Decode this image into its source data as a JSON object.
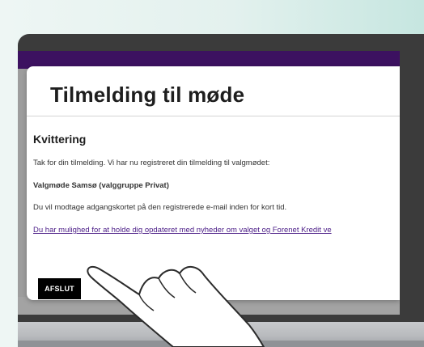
{
  "page": {
    "title": "Tilmelding til møde"
  },
  "receipt": {
    "heading": "Kvittering",
    "thanks_text": "Tak for din tilmelding. Vi har nu registreret din tilmelding til valgmødet:",
    "meeting_name": "Valgmøde Samsø (valggruppe Privat)",
    "card_info": "Du vil modtage adgangskortet på den registrerede e-mail inden for kort tid.",
    "newsletter_link": "Du har mulighed for at holde dig opdateret med nyheder om valget og Forenet Kredit ve"
  },
  "actions": {
    "finish_label": "AFSLUT"
  },
  "colors": {
    "header_bar": "#3c1160",
    "link": "#4b1d87",
    "button_bg": "#000000"
  }
}
